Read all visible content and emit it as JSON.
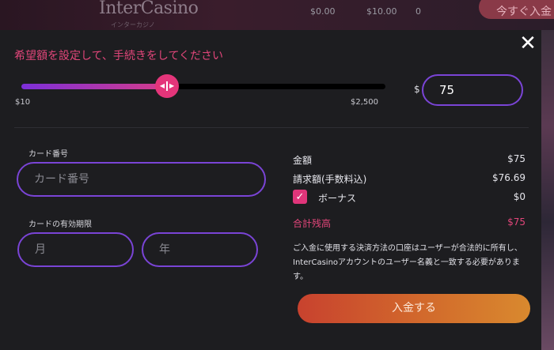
{
  "header": {
    "logo": "InterCasino",
    "logo_sub": "インターカジノ",
    "values": [
      "$0.00",
      "$10.00",
      "0"
    ],
    "cta": "今すぐ入金"
  },
  "modal": {
    "close_icon": "close-icon",
    "instruction": "希望額を設定して、手続きをしてください",
    "slider": {
      "min_label": "$10",
      "max_label": "$2,500",
      "value": 75,
      "min": 10,
      "max": 2500,
      "fill_fraction": 0.4
    },
    "currency_symbol": "$",
    "amount_value": "75",
    "card_number_label": "カード番号",
    "card_number_placeholder": "カード番号",
    "expiry_label": "カードの有効期限",
    "month_placeholder": "月",
    "year_placeholder": "年",
    "summary": {
      "amount_label": "金額",
      "amount_value": "$75",
      "billed_label": "請求額(手数料込)",
      "billed_value": "$76.69",
      "bonus_label": "ボーナス",
      "bonus_value": "$0",
      "bonus_checked": true,
      "total_label": "合計残高",
      "total_value": "$75"
    },
    "notice": "ご入金に使用する決済方法の口座はユーザーが合法的に所有し、InterCasinoアカウントのユーザー名義と一致する必要があります。",
    "deposit_button": "入金する"
  },
  "colors": {
    "accent_pink": "#e2467a",
    "border_purple": "#7a44d6",
    "button_orange": "#d26a2c"
  }
}
